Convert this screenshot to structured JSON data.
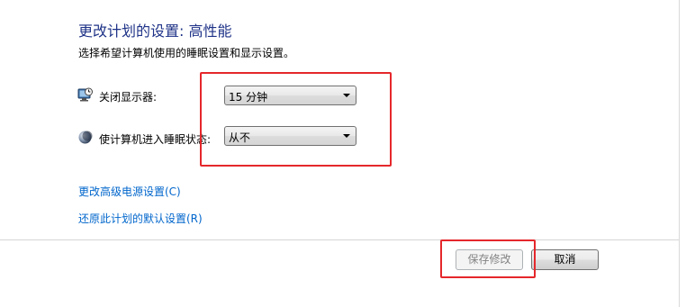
{
  "header": {
    "title": "更改计划的设置: 高性能",
    "subtitle": "选择希望计算机使用的睡眠设置和显示设置。"
  },
  "settings": [
    {
      "label": "关闭显示器:",
      "value": "15 分钟",
      "icon": "monitor-clock-icon"
    },
    {
      "label": "使计算机进入睡眠状态:",
      "value": "从不",
      "icon": "moon-sleep-icon"
    }
  ],
  "links": {
    "advanced": "更改高级电源设置(C)",
    "restore": "还原此计划的默认设置(R)"
  },
  "buttons": {
    "save": "保存修改",
    "cancel": "取消"
  },
  "colors": {
    "title": "#1e3287",
    "link": "#0066cc",
    "highlight": "#e5272b"
  }
}
